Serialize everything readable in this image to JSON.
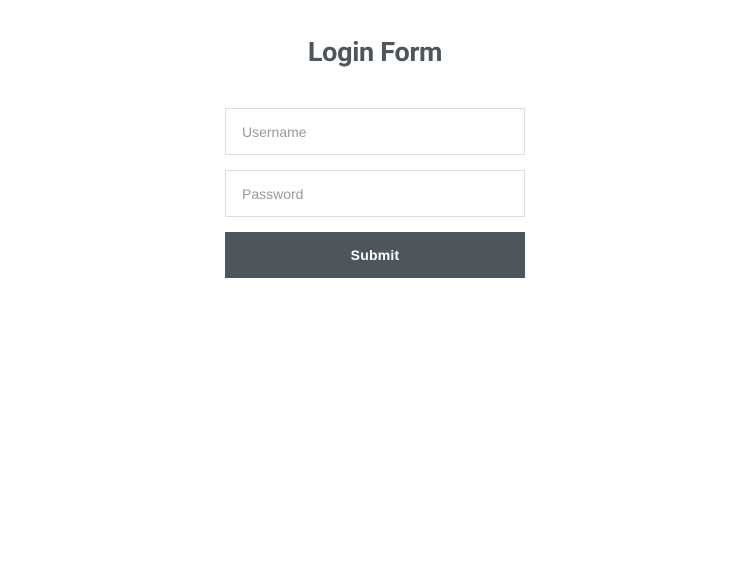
{
  "form": {
    "title": "Login Form",
    "username": {
      "placeholder": "Username",
      "value": ""
    },
    "password": {
      "placeholder": "Password",
      "value": ""
    },
    "submit_label": "Submit"
  }
}
